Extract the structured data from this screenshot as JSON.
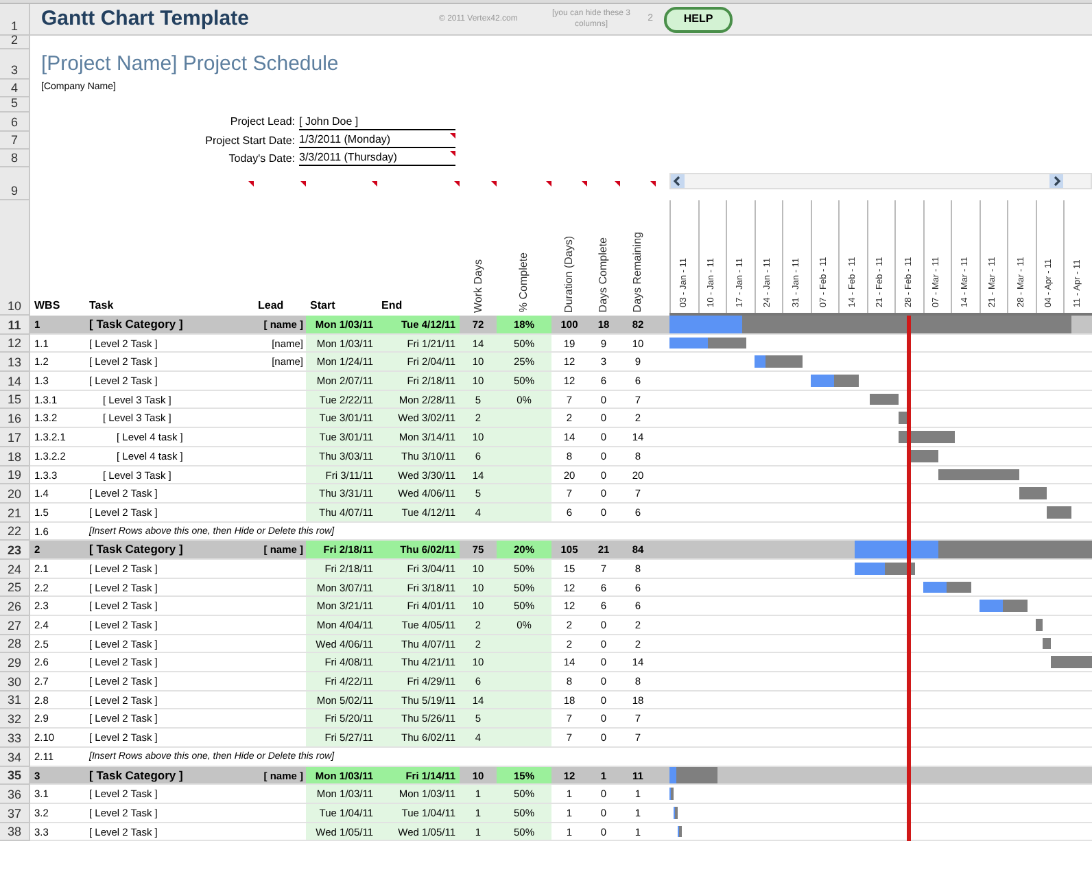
{
  "title_bar": {
    "title": "Gantt Chart Template",
    "copyright": "© 2011 Vertex42.com",
    "note": "[you can hide these 3 columns]",
    "number": "2",
    "help_button": "HELP"
  },
  "top_row_numbers": [
    "1",
    "2",
    "3",
    "4",
    "5",
    "6",
    "7",
    "8",
    "9",
    "10"
  ],
  "project": {
    "name_title": "[Project Name] Project Schedule",
    "company": "[Company Name]",
    "fields": [
      {
        "label": "Project Lead:",
        "value": "[ John Doe ]"
      },
      {
        "label": "Project Start Date:",
        "value": "1/3/2011 (Monday)"
      },
      {
        "label": "Today's Date:",
        "value": "3/3/2011 (Thursday)"
      }
    ]
  },
  "columns": [
    {
      "label": "WBS",
      "kind": "horizontal"
    },
    {
      "label": "Task",
      "kind": "horizontal"
    },
    {
      "label": "Lead",
      "kind": "horizontal"
    },
    {
      "label": "Start",
      "kind": "horizontal"
    },
    {
      "label": "End",
      "kind": "horizontal"
    },
    {
      "label": "Work Days",
      "kind": "vertical"
    },
    {
      "label": "% Complete",
      "kind": "vertical"
    },
    {
      "label": "Duration (Days)",
      "kind": "vertical"
    },
    {
      "label": "Days Complete",
      "kind": "vertical"
    },
    {
      "label": "Days Remaining",
      "kind": "vertical"
    }
  ],
  "timeline": [
    "03 - Jan - 11",
    "10 - Jan - 11",
    "17 - Jan - 11",
    "24 - Jan - 11",
    "31 - Jan - 11",
    "07 - Feb - 11",
    "14 - Feb - 11",
    "21 - Feb - 11",
    "28 - Feb - 11",
    "07 - Mar - 11",
    "14 - Mar - 11",
    "21 - Mar - 11",
    "28 - Mar - 11",
    "04 - Apr - 11",
    "11 - Apr - 11"
  ],
  "categories": [
    {
      "kind": "category",
      "row_number": "11",
      "wbs": "1",
      "task": "[ Task Category ]",
      "lead": "[ name ]",
      "start": "Mon 1/03/11",
      "end": "Tue 4/12/11",
      "work_days": "72",
      "pct_complete": "18%",
      "duration": "100",
      "days_complete": "18",
      "days_remaining": "82",
      "children": [
        {
          "kind": "task",
          "row_number": "12",
          "wbs": "1.1",
          "task": "[ Level 2 Task ]",
          "lead": "[name]",
          "start": "Mon 1/03/11",
          "end": "Fri 1/21/11",
          "work_days": "14",
          "pct_complete": "50%",
          "duration": "19",
          "days_complete": "9",
          "days_remaining": "10"
        },
        {
          "kind": "task",
          "row_number": "13",
          "wbs": "1.2",
          "task": "[ Level 2 Task ]",
          "lead": "[name]",
          "start": "Mon 1/24/11",
          "end": "Fri 2/04/11",
          "work_days": "10",
          "pct_complete": "25%",
          "duration": "12",
          "days_complete": "3",
          "days_remaining": "9"
        },
        {
          "kind": "task",
          "row_number": "14",
          "wbs": "1.3",
          "task": "[ Level 2 Task ]",
          "start": "Mon 2/07/11",
          "end": "Fri 2/18/11",
          "work_days": "10",
          "pct_complete": "50%",
          "duration": "12",
          "days_complete": "6",
          "days_remaining": "6",
          "children": [
            {
              "kind": "task",
              "row_number": "15",
              "wbs": "1.3.1",
              "task": "[ Level 3 Task ]",
              "start": "Tue 2/22/11",
              "end": "Mon 2/28/11",
              "work_days": "5",
              "pct_complete": "0%",
              "duration": "7",
              "days_complete": "0",
              "days_remaining": "7"
            },
            {
              "kind": "task",
              "row_number": "16",
              "wbs": "1.3.2",
              "task": "[ Level 3 Task ]",
              "start": "Tue 3/01/11",
              "end": "Wed 3/02/11",
              "work_days": "2",
              "duration": "2",
              "days_complete": "0",
              "days_remaining": "2",
              "children": [
                {
                  "kind": "task",
                  "row_number": "17",
                  "wbs": "1.3.2.1",
                  "task": "[ Level 4 task ]",
                  "start": "Tue 3/01/11",
                  "end": "Mon 3/14/11",
                  "work_days": "10",
                  "duration": "14",
                  "days_complete": "0",
                  "days_remaining": "14"
                },
                {
                  "kind": "task",
                  "row_number": "18",
                  "wbs": "1.3.2.2",
                  "task": "[ Level 4 task ]",
                  "start": "Thu 3/03/11",
                  "end": "Thu 3/10/11",
                  "work_days": "6",
                  "duration": "8",
                  "days_complete": "0",
                  "days_remaining": "8"
                }
              ]
            },
            {
              "kind": "task",
              "row_number": "19",
              "wbs": "1.3.3",
              "task": "[ Level 3 Task ]",
              "start": "Fri 3/11/11",
              "end": "Wed 3/30/11",
              "work_days": "14",
              "duration": "20",
              "days_complete": "0",
              "days_remaining": "20"
            }
          ]
        },
        {
          "kind": "task",
          "row_number": "20",
          "wbs": "1.4",
          "task": "[ Level 2 Task ]",
          "start": "Thu 3/31/11",
          "end": "Wed 4/06/11",
          "work_days": "5",
          "duration": "7",
          "days_complete": "0",
          "days_remaining": "7"
        },
        {
          "kind": "task",
          "row_number": "21",
          "wbs": "1.5",
          "task": "[ Level 2 Task ]",
          "start": "Thu 4/07/11",
          "end": "Tue 4/12/11",
          "work_days": "4",
          "duration": "6",
          "days_complete": "0",
          "days_remaining": "6"
        },
        {
          "kind": "note",
          "row_number": "22",
          "wbs": "1.6",
          "task": "[Insert Rows above this one, then Hide or Delete this row]"
        }
      ]
    },
    {
      "kind": "category",
      "row_number": "23",
      "wbs": "2",
      "task": "[ Task Category ]",
      "lead": "[ name ]",
      "start": "Fri 2/18/11",
      "end": "Thu 6/02/11",
      "work_days": "75",
      "pct_complete": "20%",
      "duration": "105",
      "days_complete": "21",
      "days_remaining": "84",
      "children": [
        {
          "kind": "task",
          "row_number": "24",
          "wbs": "2.1",
          "task": "[ Level 2 Task ]",
          "start": "Fri 2/18/11",
          "end": "Fri 3/04/11",
          "work_days": "10",
          "pct_complete": "50%",
          "duration": "15",
          "days_complete": "7",
          "days_remaining": "8"
        },
        {
          "kind": "task",
          "row_number": "25",
          "wbs": "2.2",
          "task": "[ Level 2 Task ]",
          "start": "Mon 3/07/11",
          "end": "Fri 3/18/11",
          "work_days": "10",
          "pct_complete": "50%",
          "duration": "12",
          "days_complete": "6",
          "days_remaining": "6"
        },
        {
          "kind": "task",
          "row_number": "26",
          "wbs": "2.3",
          "task": "[ Level 2 Task ]",
          "start": "Mon 3/21/11",
          "end": "Fri 4/01/11",
          "work_days": "10",
          "pct_complete": "50%",
          "duration": "12",
          "days_complete": "6",
          "days_remaining": "6"
        },
        {
          "kind": "task",
          "row_number": "27",
          "wbs": "2.4",
          "task": "[ Level 2 Task ]",
          "start": "Mon 4/04/11",
          "end": "Tue 4/05/11",
          "work_days": "2",
          "pct_complete": "0%",
          "duration": "2",
          "days_complete": "0",
          "days_remaining": "2"
        },
        {
          "kind": "task",
          "row_number": "28",
          "wbs": "2.5",
          "task": "[ Level 2 Task ]",
          "start": "Wed 4/06/11",
          "end": "Thu 4/07/11",
          "work_days": "2",
          "duration": "2",
          "days_complete": "0",
          "days_remaining": "2"
        },
        {
          "kind": "task",
          "row_number": "29",
          "wbs": "2.6",
          "task": "[ Level 2 Task ]",
          "start": "Fri 4/08/11",
          "end": "Thu 4/21/11",
          "work_days": "10",
          "duration": "14",
          "days_complete": "0",
          "days_remaining": "14"
        },
        {
          "kind": "task",
          "row_number": "30",
          "wbs": "2.7",
          "task": "[ Level 2 Task ]",
          "start": "Fri 4/22/11",
          "end": "Fri 4/29/11",
          "work_days": "6",
          "duration": "8",
          "days_complete": "0",
          "days_remaining": "8"
        },
        {
          "kind": "task",
          "row_number": "31",
          "wbs": "2.8",
          "task": "[ Level 2 Task ]",
          "start": "Mon 5/02/11",
          "end": "Thu 5/19/11",
          "work_days": "14",
          "duration": "18",
          "days_complete": "0",
          "days_remaining": "18"
        },
        {
          "kind": "task",
          "row_number": "32",
          "wbs": "2.9",
          "task": "[ Level 2 Task ]",
          "start": "Fri 5/20/11",
          "end": "Thu 5/26/11",
          "work_days": "5",
          "duration": "7",
          "days_complete": "0",
          "days_remaining": "7"
        },
        {
          "kind": "task",
          "row_number": "33",
          "wbs": "2.10",
          "task": "[ Level 2 Task ]",
          "start": "Fri 5/27/11",
          "end": "Thu 6/02/11",
          "work_days": "4",
          "duration": "7",
          "days_complete": "0",
          "days_remaining": "7"
        },
        {
          "kind": "note",
          "row_number": "34",
          "wbs": "2.11",
          "task": "[Insert Rows above this one, then Hide or Delete this row]"
        }
      ]
    },
    {
      "kind": "category",
      "row_number": "35",
      "wbs": "3",
      "task": "[ Task Category ]",
      "lead": "[ name ]",
      "start": "Mon 1/03/11",
      "end": "Fri 1/14/11",
      "work_days": "10",
      "pct_complete": "15%",
      "duration": "12",
      "days_complete": "1",
      "days_remaining": "11",
      "children": [
        {
          "kind": "task",
          "row_number": "36",
          "wbs": "3.1",
          "task": "[ Level 2 Task ]",
          "start": "Mon 1/03/11",
          "end": "Mon 1/03/11",
          "work_days": "1",
          "pct_complete": "50%",
          "duration": "1",
          "days_complete": "0",
          "days_remaining": "1"
        },
        {
          "kind": "task",
          "row_number": "37",
          "wbs": "3.2",
          "task": "[ Level 2 Task ]",
          "start": "Tue 1/04/11",
          "end": "Tue 1/04/11",
          "work_days": "1",
          "pct_complete": "50%",
          "duration": "1",
          "days_complete": "0",
          "days_remaining": "1"
        },
        {
          "kind": "task",
          "row_number": "38",
          "wbs": "3.3",
          "task": "[ Level 2 Task ]",
          "start": "Wed 1/05/11",
          "end": "Wed 1/05/11",
          "work_days": "1",
          "pct_complete": "50%",
          "duration": "1",
          "days_complete": "0",
          "days_remaining": "1"
        }
      ]
    }
  ]
}
